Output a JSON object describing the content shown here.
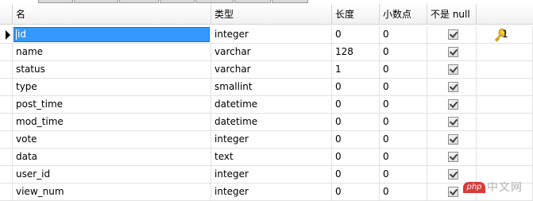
{
  "columns": {
    "name": "名",
    "type": "类型",
    "length": "长度",
    "decimals": "小数点",
    "not_null": "不是 null",
    "key": ""
  },
  "rows": [
    {
      "name": "id",
      "type": "integer",
      "length": "0",
      "decimals": "0",
      "not_null": true,
      "key": "1",
      "selected": true
    },
    {
      "name": "name",
      "type": "varchar",
      "length": "128",
      "decimals": "0",
      "not_null": true,
      "key": ""
    },
    {
      "name": "status",
      "type": "varchar",
      "length": "1",
      "decimals": "0",
      "not_null": true,
      "key": ""
    },
    {
      "name": "type",
      "type": "smallint",
      "length": "0",
      "decimals": "0",
      "not_null": true,
      "key": ""
    },
    {
      "name": "post_time",
      "type": "datetime",
      "length": "0",
      "decimals": "0",
      "not_null": true,
      "key": ""
    },
    {
      "name": "mod_time",
      "type": "datetime",
      "length": "0",
      "decimals": "0",
      "not_null": true,
      "key": ""
    },
    {
      "name": "vote",
      "type": "integer",
      "length": "0",
      "decimals": "0",
      "not_null": true,
      "key": ""
    },
    {
      "name": "data",
      "type": "text",
      "length": "0",
      "decimals": "0",
      "not_null": true,
      "key": ""
    },
    {
      "name": "user_id",
      "type": "integer",
      "length": "0",
      "decimals": "0",
      "not_null": true,
      "key": ""
    },
    {
      "name": "view_num",
      "type": "integer",
      "length": "0",
      "decimals": "0",
      "not_null": true,
      "key": ""
    }
  ],
  "icons": {
    "primary_key": "key-icon",
    "row_pointer": "triangle-right-icon",
    "checkbox": "checkbox-checked-icon"
  },
  "colors": {
    "selection": "#3399ff",
    "grid_line": "#e2e2e2",
    "key_gold": "#f2c21b"
  },
  "watermark": {
    "badge": "php",
    "text": "中文网"
  }
}
